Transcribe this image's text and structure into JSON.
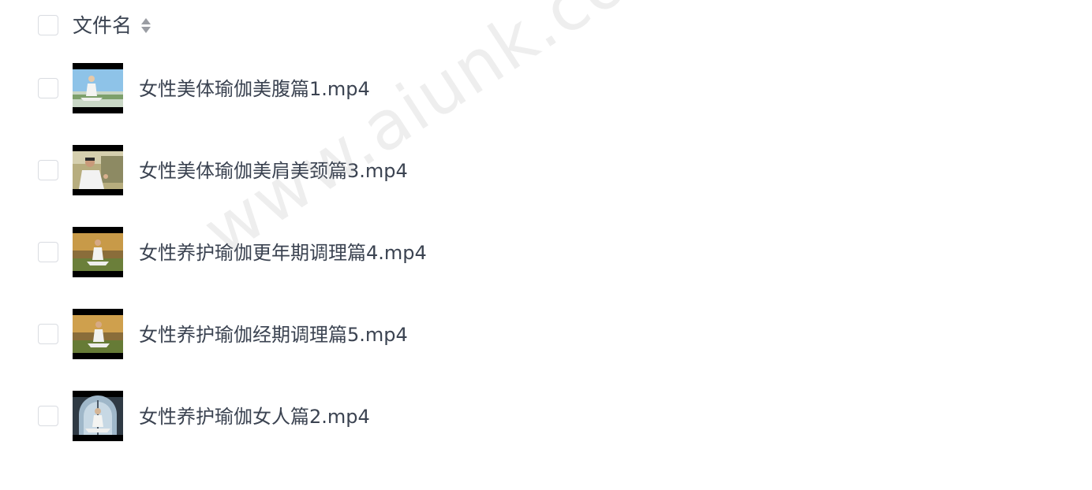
{
  "header": {
    "column_title": "文件名",
    "sort_icon": "sort-icon"
  },
  "files": [
    {
      "name": "女性美体瑜伽美腹篇1.mp4",
      "thumbnail_icon": "video-thumbnail"
    },
    {
      "name": "女性美体瑜伽美肩美颈篇3.mp4",
      "thumbnail_icon": "video-thumbnail"
    },
    {
      "name": "女性养护瑜伽更年期调理篇4.mp4",
      "thumbnail_icon": "video-thumbnail"
    },
    {
      "name": "女性养护瑜伽经期调理篇5.mp4",
      "thumbnail_icon": "video-thumbnail"
    },
    {
      "name": "女性养护瑜伽女人篇2.mp4",
      "thumbnail_icon": "video-thumbnail"
    }
  ],
  "watermark": "www.aiunk.com",
  "colors": {
    "text": "#3b4351",
    "checkbox_border": "#d9dce1",
    "sort_icon": "#9a9da3"
  }
}
